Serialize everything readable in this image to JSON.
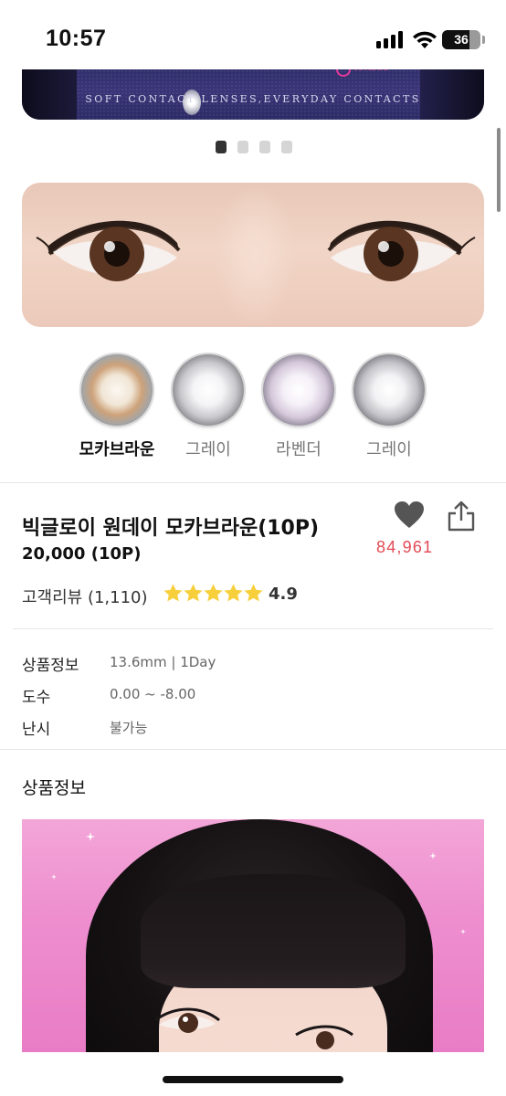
{
  "status_bar": {
    "time": "10:57",
    "battery": "36"
  },
  "banner": {
    "caption": "SOFT CONTACT LENSES,EVERYDAY CONTACTS",
    "script_text": "lenses"
  },
  "carousel": {
    "total": 4,
    "active_index": 0
  },
  "colors": {
    "accent_like": "#e24a55",
    "star": "#f7cf3b",
    "active_dot": "#333333",
    "inactive_dot": "#d5d5d5"
  },
  "lens_options": [
    {
      "label": "모카브라운",
      "active": true
    },
    {
      "label": "그레이",
      "active": false
    },
    {
      "label": "라벤더",
      "active": false
    },
    {
      "label": "그레이",
      "active": false
    }
  ],
  "product": {
    "title": "빅글로이 원데이 모카브라운(10P)",
    "price": "20,000 (10P)",
    "likes": "84,961",
    "review_label": "고객리뷰 (1,110)",
    "rating": "4.9",
    "stars": 5
  },
  "specs": [
    {
      "label": "상품정보",
      "value": "13.6mm | 1Day"
    },
    {
      "label": "도수",
      "value": "0.00 ~ -8.00"
    },
    {
      "label": "난시",
      "value": "불가능"
    }
  ],
  "section": {
    "title": "상품정보"
  }
}
